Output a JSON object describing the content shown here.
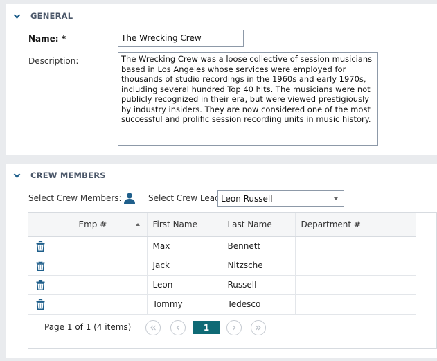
{
  "general": {
    "title": "GENERAL",
    "name_label": "Name: *",
    "name_value": "The Wrecking Crew",
    "description_label": "Description:",
    "description_value": "The Wrecking Crew was a loose collective of session musicians based in Los Angeles whose services were employed for thousands of studio recordings in the 1960s and early 1970s, including several hundred Top 40 hits. The musicians were not publicly recognized in their era, but were viewed prestigiously by industry insiders. They are now considered one of the most successful and prolific session recording units in music history."
  },
  "crew": {
    "title": "CREW MEMBERS",
    "select_members_label": "Select Crew Members:",
    "select_lead_label": "Select Crew Lead:",
    "lead_value": "Leon  Russell",
    "columns": [
      "",
      "Emp #",
      "First Name",
      "Last Name",
      "Department #"
    ],
    "rows": [
      {
        "emp": "",
        "first": "Max",
        "last": "Bennett",
        "dept": ""
      },
      {
        "emp": "",
        "first": "Jack",
        "last": "Nitzsche",
        "dept": ""
      },
      {
        "emp": "",
        "first": "Leon",
        "last": "Russell",
        "dept": ""
      },
      {
        "emp": "",
        "first": "Tommy",
        "last": "Tedesco",
        "dept": ""
      }
    ],
    "pager": {
      "summary": "Page 1 of 1 (4 items)",
      "current_page": "1"
    }
  },
  "colors": {
    "accent": "#0f6a75",
    "icon_blue": "#1f5f8b",
    "section_title": "#4a5668"
  },
  "icons": [
    "chevron-down-icon",
    "person-icon",
    "trash-icon",
    "first-page-icon",
    "prev-page-icon",
    "next-page-icon",
    "last-page-icon"
  ]
}
